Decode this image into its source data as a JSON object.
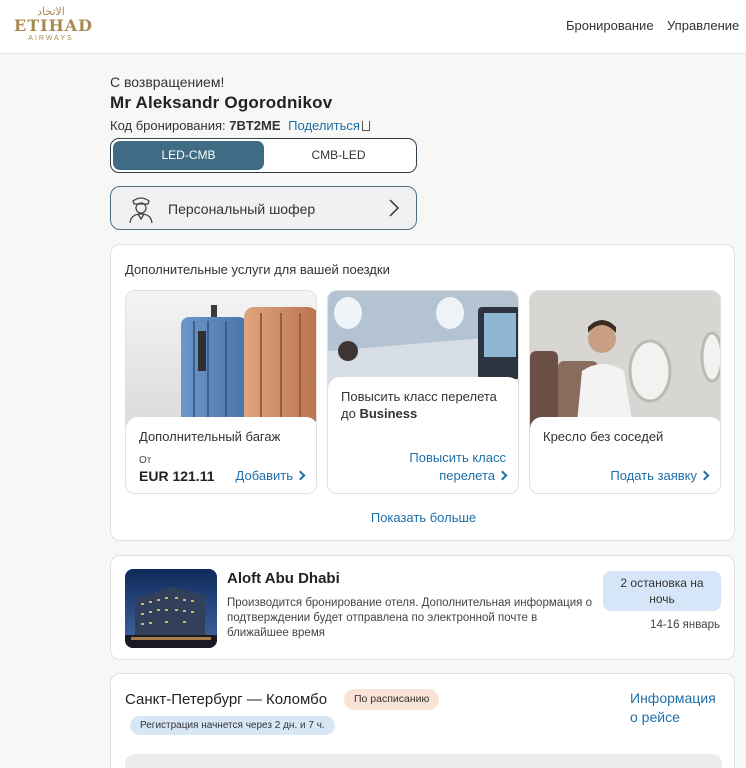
{
  "header": {
    "logo_arabic": "الاتحاد",
    "logo_main": "ETIHAD",
    "logo_sub": "AIRWAYS",
    "nav_booking": "Бронирование",
    "nav_manage": "Управление"
  },
  "trip": {
    "greeting": "С возвращением!",
    "passenger_name": "Mr Aleksandr Ogorodnikov",
    "pnr_label": "Код бронирования:",
    "pnr_code": "7BT2ME",
    "share_label": "Поделиться",
    "routes": [
      "LED-CMB",
      "CMB-LED"
    ],
    "active_route": "LED-CMB"
  },
  "chauffeur": {
    "label": "Персональный шофер",
    "icon": "chauffeur-icon"
  },
  "addons": {
    "title": "Дополнительные услуги для вашей поездки",
    "baggage": {
      "title": "Дополнительный багаж",
      "from_label": "От",
      "price": "EUR 121.11",
      "action": "Добавить"
    },
    "upgrade": {
      "title_prefix": "Повысить класс перелета до ",
      "title_bold": "Business",
      "action_line1": "Повысить класс",
      "action_line2": "перелета"
    },
    "empty_seat": {
      "title": "Кресло без соседей",
      "action": "Подать заявку"
    },
    "show_more": "Показать больше"
  },
  "hotel": {
    "name": "Aloft Abu Dhabi",
    "description": "Производится бронирование отеля. Дополнительная информация о подтверждении будет отправлена по электронной почте в ближайшее время",
    "stop_badge_line1": "2 остановка на",
    "stop_badge_line2": "ночь",
    "dates": "14-16 январь"
  },
  "flight": {
    "route": "Санкт-Петербург — Коломбо",
    "status": "По расписанию",
    "checkin": "Регистрация начнется через 2 дн. и 7 ч.",
    "info_line1": "Информация",
    "info_line2": "о рейсе"
  },
  "colors": {
    "brand_gold": "#a88a4f",
    "accent_blue": "#1f6fa8",
    "active_toggle": "#3f6c84",
    "status_badge": "#f8e3d6",
    "info_badge": "#d4e6f7"
  }
}
